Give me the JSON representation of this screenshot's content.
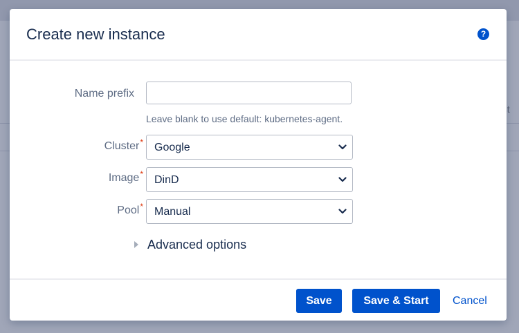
{
  "background": {
    "partial_text": "ust"
  },
  "dialog": {
    "title": "Create new instance",
    "help_icon": "help-question-icon",
    "help_glyph": "?"
  },
  "form": {
    "name_prefix": {
      "label": "Name prefix",
      "value": "",
      "placeholder": "",
      "hint": "Leave blank to use default: kubernetes-agent."
    },
    "cluster": {
      "label": "Cluster",
      "required_mark": "*",
      "selected": "Google"
    },
    "image": {
      "label": "Image",
      "required_mark": "*",
      "selected": "DinD"
    },
    "pool": {
      "label": "Pool",
      "required_mark": "*",
      "selected": "Manual"
    },
    "advanced": {
      "label": "Advanced options",
      "expanded": false
    }
  },
  "footer": {
    "save_label": "Save",
    "save_start_label": "Save & Start",
    "cancel_label": "Cancel"
  },
  "colors": {
    "primary": "#0052cc",
    "required": "#de350b",
    "text": "#172b4d",
    "muted": "#5e6c84"
  }
}
